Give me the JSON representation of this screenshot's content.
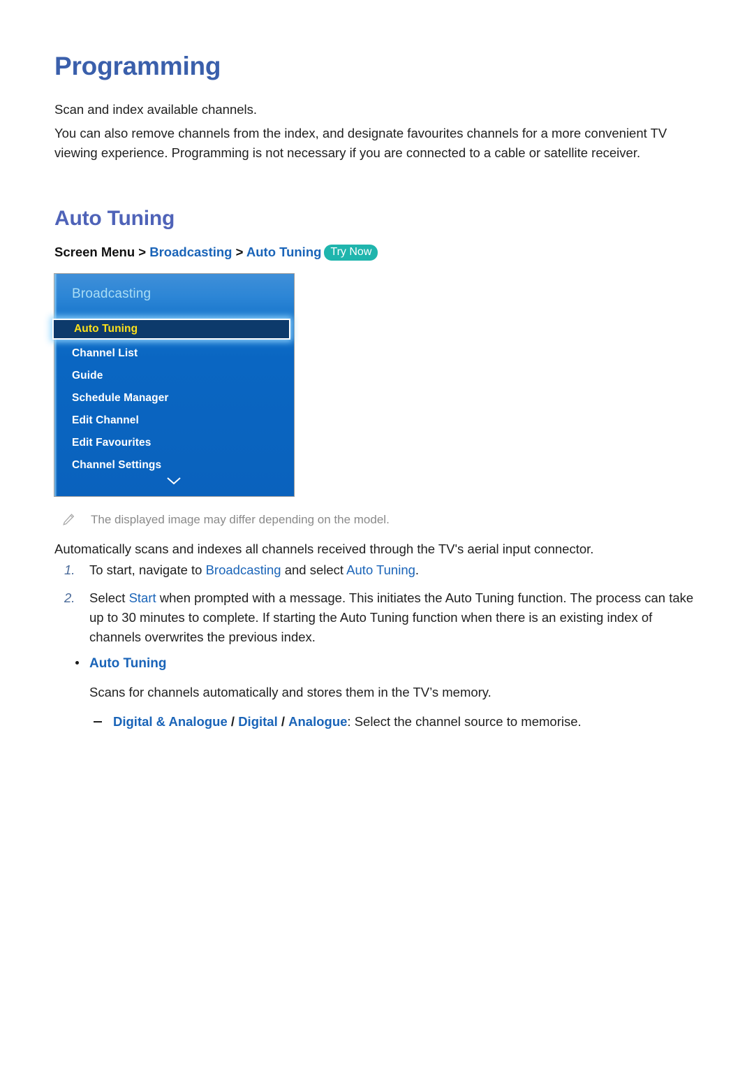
{
  "document": {
    "title": "Programming",
    "intro_paragraphs": [
      "Scan and index available channels.",
      "You can also remove channels from the index, and designate favourites channels for a more convenient TV viewing experience. Programming is not necessary if you are connected to a cable or satellite receiver."
    ]
  },
  "section": {
    "heading": "Auto Tuning",
    "breadcrumb": {
      "root": "Screen Menu",
      "separator": ">",
      "level_1": "Broadcasting",
      "level_2": "Auto Tuning",
      "badge": "Try Now"
    }
  },
  "tv_menu": {
    "header": "Broadcasting",
    "selected_item": "Auto Tuning",
    "items": [
      "Channel List",
      "Guide",
      "Schedule Manager",
      "Edit Channel",
      "Edit Favourites",
      "Channel Settings"
    ],
    "more_icon": "chevron-down-icon",
    "colors": {
      "panel_blue": "#0a66c2",
      "panel_top_blue": "#3f8fd8",
      "header_text": "#a9ddf5",
      "selected_text": "#ffe11a",
      "selected_background": "#0d3a6b",
      "item_text": "#ffffff"
    }
  },
  "note": {
    "icon": "pencil-icon",
    "text": "The displayed image may differ depending on the model."
  },
  "procedure": {
    "intro": "Automatically scans and indexes all channels received through the TV's aerial input connector.",
    "steps": [
      {
        "number": "1.",
        "parts": [
          {
            "text": "To start, navigate to ",
            "style": "plain"
          },
          {
            "text": "Broadcasting",
            "style": "link"
          },
          {
            "text": " and select ",
            "style": "plain"
          },
          {
            "text": "Auto Tuning",
            "style": "link"
          },
          {
            "text": ".",
            "style": "plain"
          }
        ]
      },
      {
        "number": "2.",
        "parts": [
          {
            "text": "Select ",
            "style": "plain"
          },
          {
            "text": "Start",
            "style": "link"
          },
          {
            "text": " when prompted with a message. This initiates the Auto Tuning function. The process can take up to 30 minutes to complete. If starting the Auto Tuning function when there is an existing index of channels overwrites the previous index.",
            "style": "plain"
          }
        ]
      }
    ]
  },
  "option": {
    "title": "Auto Tuning",
    "description": "Scans for channels automatically and stores them in the TV’s memory.",
    "sub_option": {
      "choices": [
        "Digital & Analogue",
        "Digital",
        "Analogue"
      ],
      "separator": "/",
      "description": ": Select the channel source to memorise."
    }
  },
  "colors": {
    "h1_blue": "#3a5fab",
    "h2_indigo": "#4f63b8",
    "link_blue": "#1a64b8",
    "badge_teal": "#1fb5ad",
    "note_gray": "#8a8a8a",
    "step_number": "#4a6a99"
  }
}
